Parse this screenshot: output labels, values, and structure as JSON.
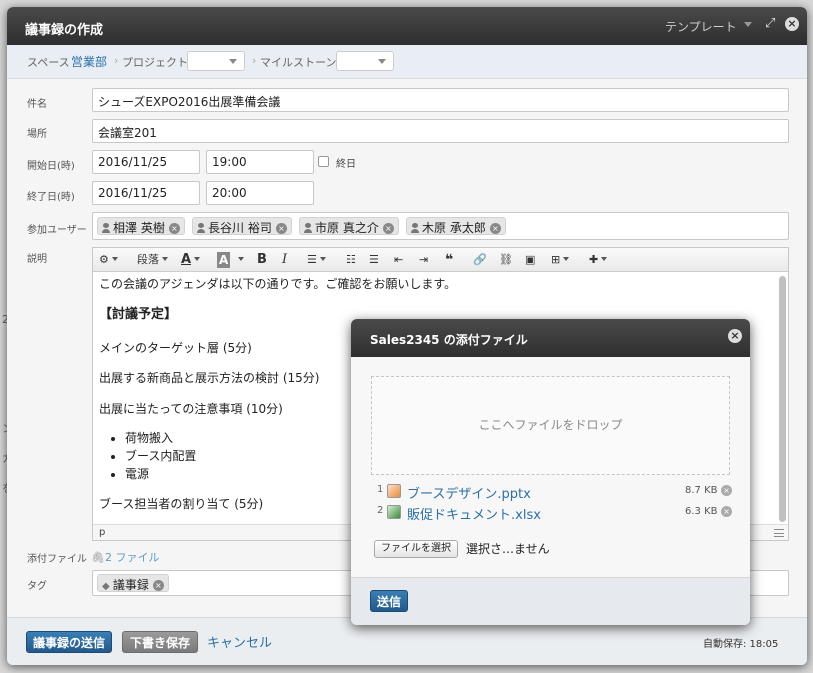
{
  "dialog": {
    "title": "議事録の作成",
    "template_label": "テンプレート"
  },
  "breadcrumb": {
    "space_label": "スペース",
    "space_value": "営業部",
    "project_label": "プロジェクト",
    "milestone_label": "マイルストーン"
  },
  "form": {
    "subject_label": "件名",
    "subject_value": "シューズEXPO2016出展準備会議",
    "place_label": "場所",
    "place_value": "会議室201",
    "start_label": "開始日(時)",
    "start_date": "2016/11/25",
    "start_time": "19:00",
    "allday_label": "終日",
    "end_label": "終了日(時)",
    "end_date": "2016/11/25",
    "end_time": "20:00",
    "participants_label": "参加ユーザー",
    "participants": [
      "相澤 英樹",
      "長谷川 裕司",
      "市原 真之介",
      "木原 承太郎"
    ],
    "description_label": "説明",
    "attachments_label": "添付ファイル",
    "attachments_link": "2 ファイル",
    "tags_label": "タグ",
    "tag_value": "議事録"
  },
  "toolbar": {
    "paragraph_label": "段落",
    "bold": "B",
    "italic": "I"
  },
  "editor": {
    "line1": "この会議のアジェンダは以下の通りです。ご確認をお願いします。",
    "heading": "【討議予定】",
    "item1": "メインのターゲット層 (5分)",
    "item2": "出展する新商品と展示方法の検討 (15分)",
    "item3": "出展に当たっての注意事項 (10分)",
    "bullets": [
      "荷物搬入",
      "ブース内配置",
      "電源"
    ],
    "item4": "ブース担当者の割り当て (5分)",
    "status_path": "p"
  },
  "footer": {
    "submit_label": "議事録の送信",
    "draft_label": "下書き保存",
    "cancel_label": "キャンセル",
    "autosave": "自動保存: 18:05"
  },
  "popup": {
    "title": "Sales2345 の添付ファイル",
    "drop_text": "ここへファイルをドロップ",
    "files": [
      {
        "num": "1",
        "name": "ブースデザイン.pptx",
        "size": "8.7 KB"
      },
      {
        "num": "2",
        "name": "販促ドキュメント.xlsx",
        "size": "6.3 KB"
      }
    ],
    "choose_label": "ファイルを選択",
    "no_file": "選択さ…ません",
    "send_label": "送信"
  }
}
